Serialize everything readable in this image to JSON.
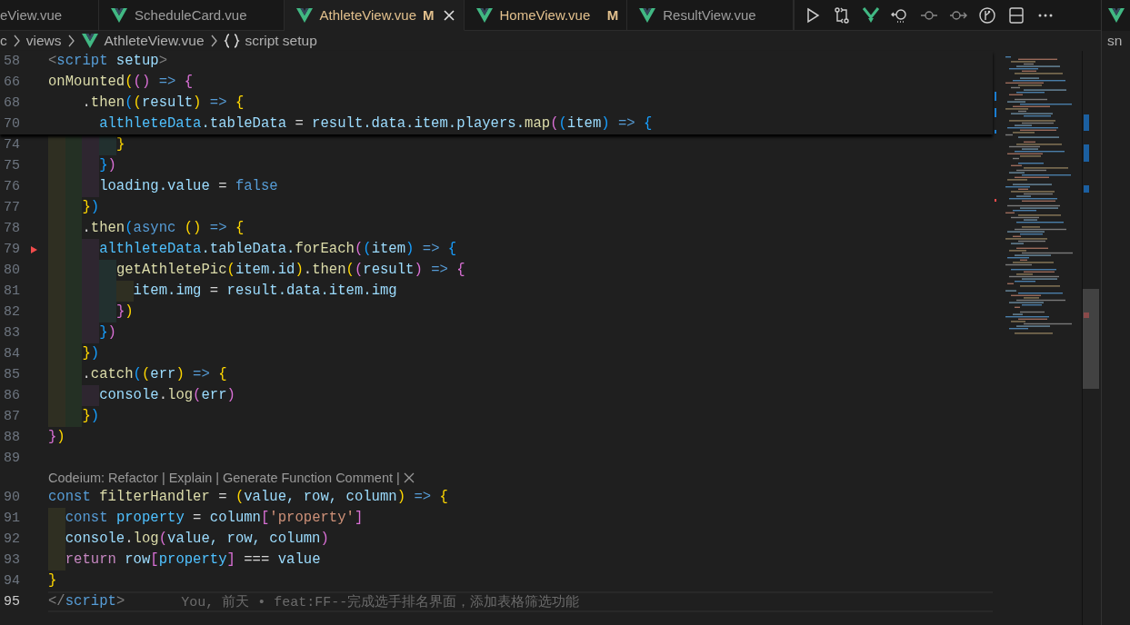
{
  "editor_tabs": [
    {
      "kind": "clipped",
      "label": "eView.vue",
      "selected": false
    },
    {
      "kind": "vue",
      "label": "ScheduleCard.vue",
      "selected": false
    },
    {
      "kind": "vue",
      "label": "AthleteView.vue",
      "status": "M",
      "selected": true
    },
    {
      "kind": "vue",
      "label": "HomeView.vue",
      "status": "M",
      "selected": false
    },
    {
      "kind": "vue",
      "label": "ResultView.vue",
      "selected": false
    }
  ],
  "breadcrumb": [
    {
      "kind": "folder",
      "text": "c"
    },
    {
      "kind": "folder",
      "text": "views"
    },
    {
      "kind": "vue-file",
      "text": "AthleteView.vue"
    },
    {
      "kind": "symbol",
      "text": "script setup"
    }
  ],
  "sticky_lines": [
    {
      "number": "58",
      "tokens": [
        {
          "kind": "punct",
          "text": "<"
        },
        {
          "kind": "tag",
          "text": "script"
        },
        {
          "kind": "attr",
          "text": " setup"
        },
        {
          "kind": "punct",
          "text": ">"
        }
      ]
    },
    {
      "number": "66",
      "tokens": [
        {
          "kind": "fn",
          "text": "onMounted"
        },
        {
          "kind": "br1",
          "text": "("
        },
        {
          "kind": "br2",
          "text": "()"
        },
        {
          "kind": "kw",
          "text": " => "
        },
        {
          "kind": "br2",
          "text": "{"
        }
      ]
    },
    {
      "number": "68",
      "tokens": [
        {
          "kind": "plain",
          "text": "    ."
        },
        {
          "kind": "fn",
          "text": "then"
        },
        {
          "kind": "br3",
          "text": "("
        },
        {
          "kind": "br1",
          "text": "("
        },
        {
          "kind": "var",
          "text": "result"
        },
        {
          "kind": "br1",
          "text": ")"
        },
        {
          "kind": "kw",
          "text": " => "
        },
        {
          "kind": "br1",
          "text": "{"
        }
      ]
    },
    {
      "number": "70",
      "tokens": [
        {
          "kind": "const",
          "text": "      althleteData"
        },
        {
          "kind": "var",
          "text": ".tableData"
        },
        {
          "kind": "plain",
          "text": " = "
        },
        {
          "kind": "var",
          "text": "result.data.item.players."
        },
        {
          "kind": "fn",
          "text": "map"
        },
        {
          "kind": "br2",
          "text": "("
        },
        {
          "kind": "br3",
          "text": "("
        },
        {
          "kind": "var",
          "text": "item"
        },
        {
          "kind": "br3",
          "text": ")"
        },
        {
          "kind": "kw",
          "text": " => "
        },
        {
          "kind": "br3",
          "text": "{"
        }
      ]
    }
  ],
  "lines": [
    {
      "number": "74",
      "current": false,
      "tokens": [
        {
          "kind": "br1",
          "text": "        }"
        }
      ]
    },
    {
      "number": "75",
      "current": false,
      "tokens": [
        {
          "kind": "br3",
          "text": "      }"
        },
        {
          "kind": "br2",
          "text": ")"
        }
      ]
    },
    {
      "number": "76",
      "current": false,
      "tokens": [
        {
          "kind": "var",
          "text": "      loading.value"
        },
        {
          "kind": "plain",
          "text": " = "
        },
        {
          "kind": "kw",
          "text": "false"
        }
      ]
    },
    {
      "number": "77",
      "current": false,
      "tokens": [
        {
          "kind": "br1",
          "text": "    }"
        },
        {
          "kind": "br3",
          "text": ")"
        }
      ]
    },
    {
      "number": "78",
      "current": false,
      "tokens": [
        {
          "kind": "plain",
          "text": "    ."
        },
        {
          "kind": "fn",
          "text": "then"
        },
        {
          "kind": "br3",
          "text": "("
        },
        {
          "kind": "kw",
          "text": "async "
        },
        {
          "kind": "br1",
          "text": "()"
        },
        {
          "kind": "kw",
          "text": " => "
        },
        {
          "kind": "br1",
          "text": "{"
        }
      ]
    },
    {
      "number": "79",
      "current": false,
      "deletion_marker": true,
      "tokens": [
        {
          "kind": "const",
          "text": "      althleteData"
        },
        {
          "kind": "var",
          "text": ".tableData."
        },
        {
          "kind": "fn",
          "text": "forEach"
        },
        {
          "kind": "br2",
          "text": "("
        },
        {
          "kind": "br3",
          "text": "("
        },
        {
          "kind": "var",
          "text": "item"
        },
        {
          "kind": "br3",
          "text": ")"
        },
        {
          "kind": "kw",
          "text": " => "
        },
        {
          "kind": "br3",
          "text": "{"
        }
      ]
    },
    {
      "number": "80",
      "current": false,
      "tokens": [
        {
          "kind": "fn",
          "text": "        getAthletePic"
        },
        {
          "kind": "br1",
          "text": "("
        },
        {
          "kind": "var",
          "text": "item.id"
        },
        {
          "kind": "br1",
          "text": ")"
        },
        {
          "kind": "plain",
          "text": "."
        },
        {
          "kind": "fn",
          "text": "then"
        },
        {
          "kind": "br1",
          "text": "("
        },
        {
          "kind": "br2",
          "text": "("
        },
        {
          "kind": "var",
          "text": "result"
        },
        {
          "kind": "br2",
          "text": ")"
        },
        {
          "kind": "kw",
          "text": " => "
        },
        {
          "kind": "br2",
          "text": "{"
        }
      ]
    },
    {
      "number": "81",
      "current": false,
      "tokens": [
        {
          "kind": "var",
          "text": "          item.img"
        },
        {
          "kind": "plain",
          "text": " = "
        },
        {
          "kind": "var",
          "text": "result.data.item.img"
        }
      ]
    },
    {
      "number": "82",
      "current": false,
      "tokens": [
        {
          "kind": "br2",
          "text": "        }"
        },
        {
          "kind": "br1",
          "text": ")"
        }
      ]
    },
    {
      "number": "83",
      "current": false,
      "tokens": [
        {
          "kind": "br3",
          "text": "      }"
        },
        {
          "kind": "br2",
          "text": ")"
        }
      ]
    },
    {
      "number": "84",
      "current": false,
      "tokens": [
        {
          "kind": "br1",
          "text": "    }"
        },
        {
          "kind": "br3",
          "text": ")"
        }
      ]
    },
    {
      "number": "85",
      "current": false,
      "tokens": [
        {
          "kind": "plain",
          "text": "    ."
        },
        {
          "kind": "fn",
          "text": "catch"
        },
        {
          "kind": "br3",
          "text": "("
        },
        {
          "kind": "br1",
          "text": "("
        },
        {
          "kind": "var",
          "text": "err"
        },
        {
          "kind": "br1",
          "text": ")"
        },
        {
          "kind": "kw",
          "text": " => "
        },
        {
          "kind": "br1",
          "text": "{"
        }
      ]
    },
    {
      "number": "86",
      "current": false,
      "tokens": [
        {
          "kind": "var",
          "text": "      console"
        },
        {
          "kind": "plain",
          "text": "."
        },
        {
          "kind": "fn",
          "text": "log"
        },
        {
          "kind": "br2",
          "text": "("
        },
        {
          "kind": "var",
          "text": "err"
        },
        {
          "kind": "br2",
          "text": ")"
        }
      ]
    },
    {
      "number": "87",
      "current": false,
      "tokens": [
        {
          "kind": "br1",
          "text": "    }"
        },
        {
          "kind": "br3",
          "text": ")"
        }
      ]
    },
    {
      "number": "88",
      "current": false,
      "tokens": [
        {
          "kind": "br2",
          "text": "}"
        },
        {
          "kind": "br1",
          "text": ")"
        }
      ]
    },
    {
      "number": "89",
      "current": false
    },
    {
      "kind": "codelens",
      "items": [
        {
          "kind": "action",
          "text": "Codeium: Refactor"
        },
        {
          "kind": "separator",
          "text": "|"
        },
        {
          "kind": "action",
          "text": "Explain"
        },
        {
          "kind": "separator",
          "text": "|"
        },
        {
          "kind": "action",
          "text": "Generate Function Comment"
        },
        {
          "kind": "separator",
          "text": "|"
        },
        {
          "kind": "close"
        }
      ]
    },
    {
      "number": "90",
      "current": false,
      "tokens": [
        {
          "kind": "kw",
          "text": "const "
        },
        {
          "kind": "fn",
          "text": "filterHandler"
        },
        {
          "kind": "plain",
          "text": " = "
        },
        {
          "kind": "br1",
          "text": "("
        },
        {
          "kind": "var",
          "text": "value, row, column"
        },
        {
          "kind": "br1",
          "text": ")"
        },
        {
          "kind": "kw",
          "text": " => "
        },
        {
          "kind": "br1",
          "text": "{"
        }
      ]
    },
    {
      "number": "91",
      "current": false,
      "tokens": [
        {
          "kind": "kw",
          "text": "  const "
        },
        {
          "kind": "const",
          "text": "property"
        },
        {
          "kind": "plain",
          "text": " = "
        },
        {
          "kind": "var",
          "text": "column"
        },
        {
          "kind": "br2",
          "text": "["
        },
        {
          "kind": "str",
          "text": "'property'"
        },
        {
          "kind": "br2",
          "text": "]"
        }
      ]
    },
    {
      "number": "92",
      "current": false,
      "tokens": [
        {
          "kind": "var",
          "text": "  console"
        },
        {
          "kind": "plain",
          "text": "."
        },
        {
          "kind": "fn",
          "text": "log"
        },
        {
          "kind": "br2",
          "text": "("
        },
        {
          "kind": "var",
          "text": "value, row, column"
        },
        {
          "kind": "br2",
          "text": ")"
        }
      ]
    },
    {
      "number": "93",
      "current": false,
      "tokens": [
        {
          "kind": "ctrl",
          "text": "  return "
        },
        {
          "kind": "var",
          "text": "row"
        },
        {
          "kind": "br2",
          "text": "["
        },
        {
          "kind": "const",
          "text": "property"
        },
        {
          "kind": "br2",
          "text": "]"
        },
        {
          "kind": "plain",
          "text": " === "
        },
        {
          "kind": "var",
          "text": "value"
        }
      ]
    },
    {
      "number": "94",
      "current": false,
      "tokens": [
        {
          "kind": "br1",
          "text": "}"
        }
      ]
    },
    {
      "number": "95",
      "current": true,
      "tokens": [
        {
          "kind": "punct",
          "text": "</"
        },
        {
          "kind": "tag",
          "text": "script"
        },
        {
          "kind": "punct",
          "text": ">"
        }
      ],
      "blame": "You, 前天 • feat:FF--完成选手排名界面，添加表格筛选功能"
    }
  ],
  "second_group": {
    "breadcrumb": "sn"
  }
}
